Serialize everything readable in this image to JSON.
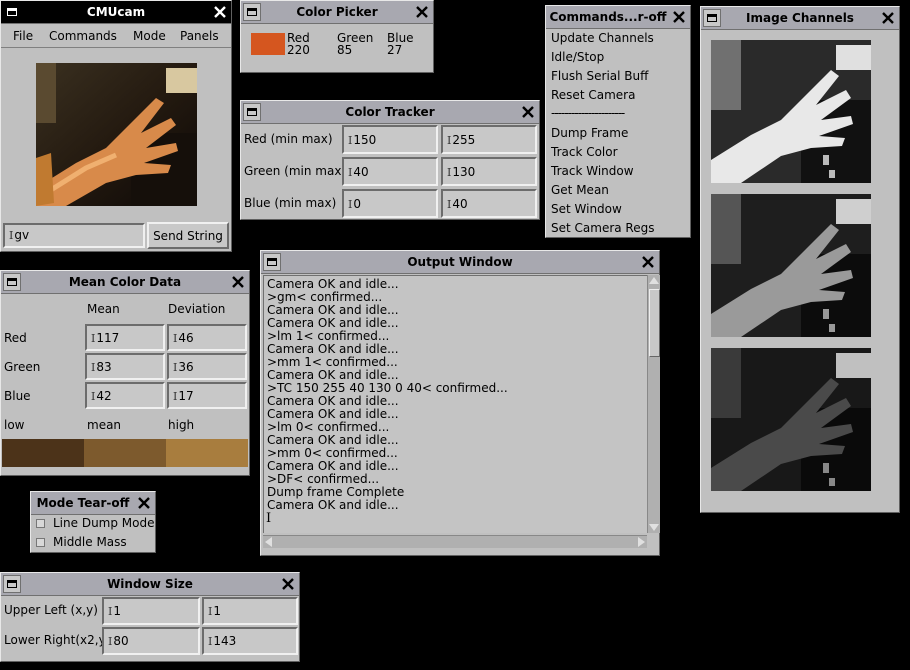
{
  "cmucam": {
    "title": "CMUcam",
    "menu": [
      "File",
      "Commands",
      "Mode",
      "Panels"
    ],
    "send_input_value": "gv",
    "send_button": "Send String"
  },
  "color_picker": {
    "title": "Color Picker",
    "swatch_color": "#d5561f",
    "labels": [
      "Red",
      "Green",
      "Blue"
    ],
    "values": [
      "220",
      "85",
      "27"
    ]
  },
  "color_tracker": {
    "title": "Color Tracker",
    "rows": [
      {
        "label": "Red (min max)",
        "min": "150",
        "max": "255"
      },
      {
        "label": "Green (min max)",
        "min": "40",
        "max": "130"
      },
      {
        "label": "Blue (min max)",
        "min": "0",
        "max": "40"
      }
    ]
  },
  "commands": {
    "title": "Commands...r-off",
    "items": [
      "Update Channels",
      "Idle/Stop",
      "Flush Serial Buff",
      "Reset Camera",
      "----------------------",
      "Dump Frame",
      "Track Color",
      "Track Window",
      "Get Mean",
      "Set Window",
      "Set Camera Regs"
    ]
  },
  "image_channels": {
    "title": "Image Channels"
  },
  "mean_color": {
    "title": "Mean Color Data",
    "headers": [
      "Mean",
      "Deviation"
    ],
    "rows": [
      {
        "label": "Red",
        "mean": "117",
        "dev": "46"
      },
      {
        "label": "Green",
        "mean": "83",
        "dev": "36"
      },
      {
        "label": "Blue",
        "mean": "42",
        "dev": "17"
      }
    ],
    "swatch_labels": [
      "low",
      "mean",
      "high"
    ],
    "swatch_colors": [
      "#4c3319",
      "#7d5a2d",
      "#a87d3e"
    ]
  },
  "output": {
    "title": "Output Window",
    "lines": [
      "Camera OK and idle...",
      ">gm< confirmed...",
      "Camera OK and idle...",
      "Camera OK and idle...",
      ">lm 1< confirmed...",
      "Camera OK and idle...",
      ">mm 1< confirmed...",
      "Camera OK and idle...",
      ">TC 150 255 40 130 0 40< confirmed...",
      "Camera OK and idle...",
      "Camera OK and idle...",
      ">lm 0< confirmed...",
      "Camera OK and idle...",
      ">mm 0< confirmed...",
      "Camera OK and idle...",
      ">DF< confirmed...",
      "Dump frame Complete",
      "Camera OK and idle..."
    ]
  },
  "mode_tearoff": {
    "title": "Mode Tear-off",
    "items": [
      "Line Dump Mode",
      "Middle Mass"
    ]
  },
  "window_size": {
    "title": "Window Size",
    "rows": [
      {
        "label": "Upper Left (x,y)",
        "a": "1",
        "b": "1"
      },
      {
        "label": "Lower Right(x2,y",
        "a": "80",
        "b": "143"
      }
    ]
  }
}
